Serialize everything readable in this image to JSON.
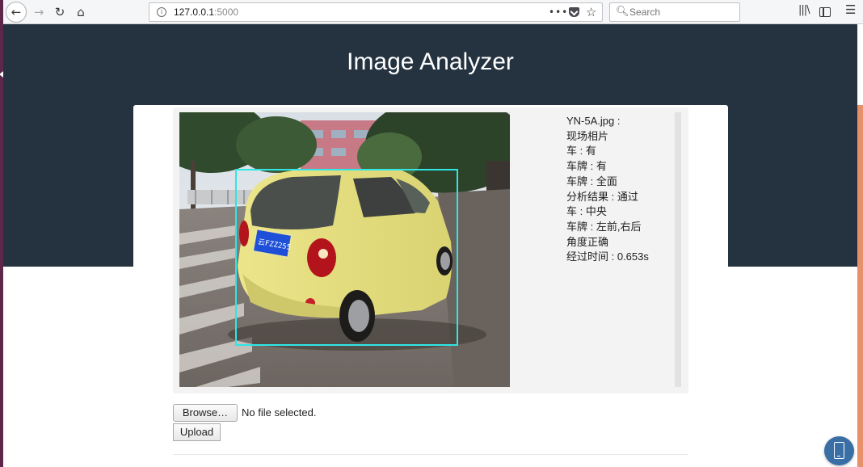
{
  "browser": {
    "url_host": "127.0.0.1",
    "url_port": ":5000",
    "search_placeholder": "Search",
    "page_actions": "•••"
  },
  "page": {
    "title": "Image Analyzer"
  },
  "result": {
    "lines": [
      "YN-5A.jpg :",
      "现场相片",
      "车 : 有",
      "车牌 : 有",
      "车牌 : 全面",
      "分析结果 : 通过",
      "车 : 中央",
      "车牌 : 左前,右后",
      "角度正确",
      "经过时间 : 0.653s"
    ],
    "plate_text": "云FZZ255",
    "box_color": "#2ee6e6"
  },
  "upload": {
    "browse_label": "Browse…",
    "file_status": "No file selected.",
    "upload_label": "Upload"
  },
  "icons": {
    "back": "back-arrow-icon",
    "forward": "forward-arrow-icon",
    "reload": "reload-icon",
    "home": "home-icon",
    "bookmark": "star-icon",
    "library": "library-icon",
    "menu": "hamburger-menu-icon"
  },
  "colors": {
    "header_bg": "#253341",
    "accent_orange": "#e8906a"
  }
}
